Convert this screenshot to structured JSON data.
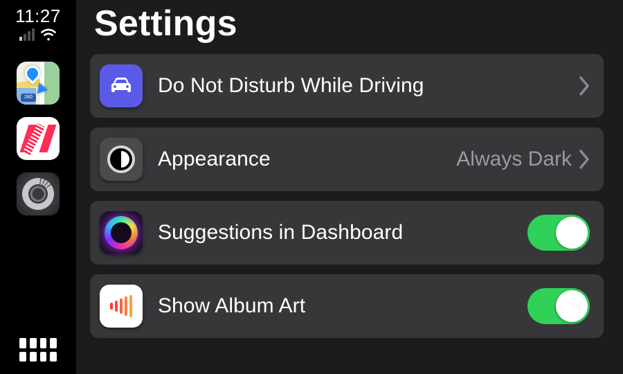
{
  "status": {
    "time": "11:27"
  },
  "sidebar": {
    "apps": [
      {
        "name": "maps"
      },
      {
        "name": "news"
      },
      {
        "name": "settings"
      }
    ]
  },
  "page": {
    "title": "Settings"
  },
  "rows": {
    "dnd": {
      "label": "Do Not Disturb While Driving",
      "accessory": "chevron"
    },
    "appearance": {
      "label": "Appearance",
      "value": "Always Dark",
      "accessory": "chevron"
    },
    "suggestions": {
      "label": "Suggestions in Dashboard",
      "switch": true
    },
    "albumart": {
      "label": "Show Album Art",
      "switch": true
    }
  },
  "colors": {
    "rowBg": "#37373a",
    "switchOn": "#30d158",
    "dndIcon": "#5a5ae6"
  }
}
